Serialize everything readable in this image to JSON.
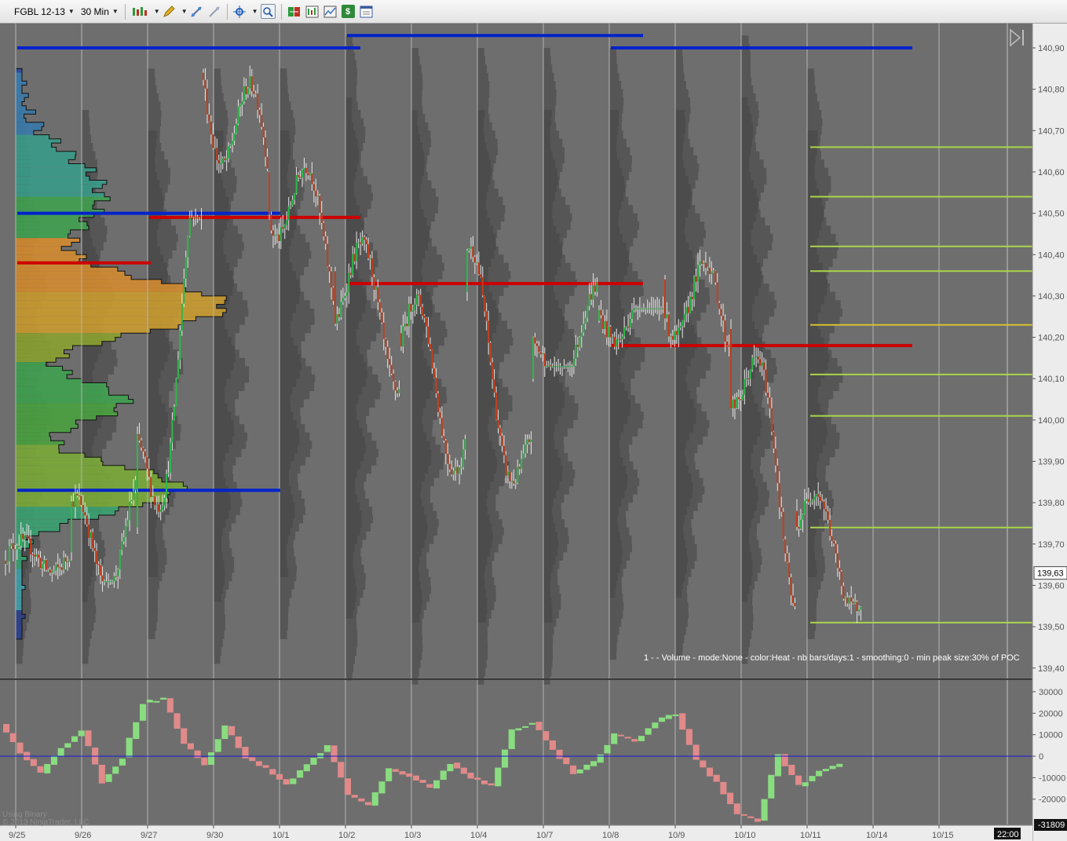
{
  "toolbar": {
    "instrument": "FGBL 12-13",
    "interval": "30 Min",
    "icons": [
      "bar-type-icon",
      "drawing-pencil-icon",
      "drawing-tools-icon",
      "eraser-icon",
      "crosshair-icon",
      "zoom-icon",
      "data-box-icon",
      "chart-style-icon",
      "indicators-icon",
      "strategies-icon",
      "properties-icon"
    ]
  },
  "price_axis": {
    "labels": [
      "140,90",
      "140,80",
      "140,70",
      "140,60",
      "140,50",
      "140,40",
      "140,30",
      "140,20",
      "140,10",
      "140,00",
      "139,90",
      "139,80",
      "139,70",
      "139,60",
      "139,50",
      "139,40"
    ],
    "current_price": "139,63"
  },
  "indicator_axis": {
    "labels": [
      "30000",
      "20000",
      "10000",
      "0",
      "-10000",
      "-20000"
    ],
    "current_value": "-31809"
  },
  "time_axis": {
    "labels": [
      "9/25",
      "9/26",
      "9/27",
      "9/30",
      "10/1",
      "10/2",
      "10/3",
      "10/4",
      "10/7",
      "10/8",
      "10/9",
      "10/10",
      "10/11",
      "10/14",
      "10/15"
    ],
    "current_time": "22:00"
  },
  "indicator_caption": "1 -   - Volume - mode:None - color:Heat - nb bars/days:1 - smoothing:0 - min peak size:30% of POC",
  "watermark": {
    "line1": "Using Binary",
    "line2": "© 2013 NinjaTrader, LLC"
  },
  "colors": {
    "background": "#6e6e6e",
    "profile_dark": "#565656",
    "va_line": "#0022cc",
    "poc_line": "#cc0000",
    "level_line": "#a9d64a",
    "level_highlight": "#d8c030",
    "up_candle": "#2db84a",
    "down_candle": "#c0401e",
    "zero_line": "#1818d8"
  },
  "chart_data": [
    {
      "type": "candlestick",
      "title": "",
      "x": [
        "9/25",
        "9/26",
        "9/27",
        "9/30",
        "10/1",
        "10/2",
        "10/3",
        "10/4",
        "10/7",
        "10/8",
        "10/9",
        "10/10",
        "10/11"
      ],
      "ylim": [
        139.36,
        140.95
      ],
      "series": [
        {
          "open": [
            139.66,
            139.68,
            139.74,
            140.84,
            140.6,
            140.36,
            140.21,
            140.31,
            140.1,
            140.24,
            140.34,
            140.22,
            139.78
          ],
          "high": [
            139.74,
            140.1,
            140.5,
            140.87,
            140.66,
            140.46,
            140.33,
            140.43,
            140.46,
            140.28,
            140.65,
            140.2,
            139.86
          ],
          "low": [
            139.57,
            139.6,
            139.58,
            140.26,
            140.13,
            139.92,
            139.75,
            139.81,
            140.12,
            139.96,
            140.17,
            139.54,
            139.47
          ],
          "close": [
            139.68,
            139.74,
            140.46,
            140.6,
            140.4,
            140.2,
            139.98,
            139.86,
            140.24,
            140.34,
            140.22,
            139.7,
            139.62
          ]
        }
      ],
      "value_area_high": [
        140.9,
        null,
        null,
        null,
        null,
        140.93,
        null,
        null,
        null,
        140.9,
        null,
        null,
        null
      ],
      "poc": [
        140.38,
        null,
        140.49,
        null,
        null,
        140.33,
        null,
        null,
        null,
        140.18,
        null,
        null,
        null
      ],
      "value_area_low": [
        140.5,
        null,
        null,
        null,
        null,
        null,
        null,
        null,
        null,
        null,
        null,
        null,
        null
      ],
      "levels": [
        140.66,
        140.54,
        140.42,
        140.36,
        140.23,
        140.11,
        140.01,
        139.74,
        139.51
      ]
    },
    {
      "type": "bar",
      "title": "",
      "ylim": [
        -32000,
        33000
      ],
      "values": [
        15000,
        2000,
        -8000,
        4000,
        12000,
        -12000,
        -500,
        25000,
        27000,
        6000,
        -4000,
        14000,
        -500,
        -6000,
        -13000,
        -4000,
        5000,
        -18000,
        -23000,
        -6000,
        -9000,
        -15000,
        -3000,
        -10000,
        -14000,
        12000,
        16000,
        3000,
        -8000,
        -3000,
        10000,
        7000,
        16000,
        20000,
        -2000,
        -12000,
        -27000,
        -30000,
        1000,
        -14000,
        -7000,
        -4000
      ]
    }
  ]
}
